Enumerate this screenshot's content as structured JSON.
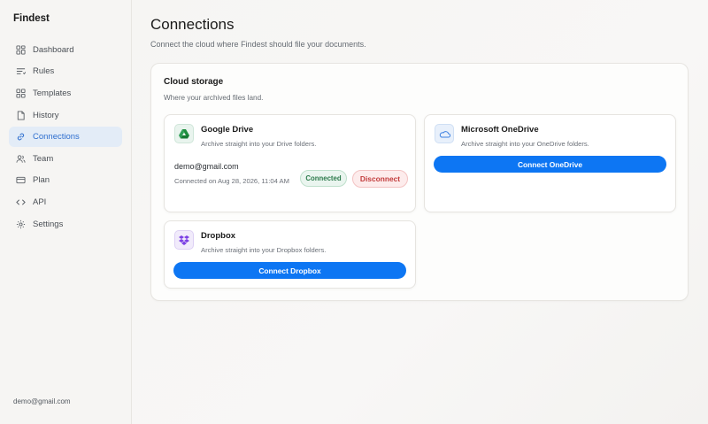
{
  "app": {
    "name": "Findest"
  },
  "sidebar": {
    "items": [
      {
        "label": "Dashboard",
        "icon": "dashboard-icon",
        "active": false
      },
      {
        "label": "Rules",
        "icon": "rules-icon",
        "active": false
      },
      {
        "label": "Templates",
        "icon": "templates-icon",
        "active": false
      },
      {
        "label": "History",
        "icon": "history-icon",
        "active": false
      },
      {
        "label": "Connections",
        "icon": "link-icon",
        "active": true
      },
      {
        "label": "Team",
        "icon": "team-icon",
        "active": false
      },
      {
        "label": "Plan",
        "icon": "credit-card-icon",
        "active": false
      },
      {
        "label": "API",
        "icon": "code-icon",
        "active": false
      },
      {
        "label": "Settings",
        "icon": "gear-icon",
        "active": false
      }
    ],
    "footer_email": "demo@gmail.com"
  },
  "main": {
    "title": "Connections",
    "subtitle": "Connect the cloud where Findest should file your documents."
  },
  "cloud_storage": {
    "title": "Cloud storage",
    "subtitle": "Where your archived files land.",
    "providers": {
      "google_drive": {
        "name": "Google Drive",
        "description": "Archive straight into your Drive folders.",
        "account_email": "demo@gmail.com",
        "connected_on": "Connected on Aug 28, 2026, 11:04 AM",
        "status": "Connected",
        "disconnect_label": "Disconnect"
      },
      "onedrive": {
        "name": "Microsoft OneDrive",
        "description": "Archive straight into your OneDrive folders.",
        "connect_label": "Connect OneDrive"
      },
      "dropbox": {
        "name": "Dropbox",
        "description": "Archive straight into your Dropbox folders.",
        "connect_label": "Connect Dropbox"
      }
    }
  },
  "colors": {
    "accent": "#0d76f3",
    "active_nav_bg": "#e3ecf7",
    "connected_green": "#2c7a4b",
    "disconnect_red": "#c23b3b"
  }
}
